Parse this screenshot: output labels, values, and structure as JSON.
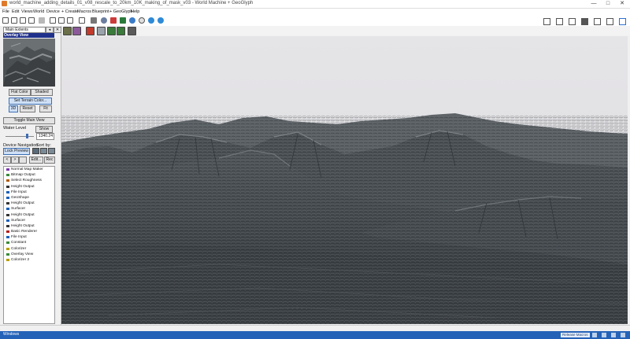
{
  "window": {
    "title": "world_machine_adding_details_01_v08_rescale_to_20km_10K_making_of_mask_v03 - World Machine + GeoGlyph",
    "controls": {
      "minimize": "—",
      "maximize": "□",
      "close": "✕"
    }
  },
  "menu": [
    "File",
    "Edit",
    "Views",
    "World",
    "Device",
    "+ Create",
    "Macros",
    "Blueprint",
    "+ GeoGlyph",
    "Help"
  ],
  "left_panel": {
    "view_dropdown": "Main Extents",
    "overlay_label": "Overlay View",
    "flat_color": "Flat Color",
    "shaded": "Shaded",
    "set_terrain_color": "Set Terrain Color...",
    "btn_3d": "3D",
    "btn_reset": "Reset",
    "btn_fit": "Fit",
    "toggle_main_view": "Toggle Main View",
    "water_level_label": "Water Level",
    "water_show": "Show",
    "water_value": "1340.24",
    "water_level_fraction": 0.78,
    "device_navigation_label": "Device Navigation",
    "sort_by_label": "Sort by:",
    "lock_preview": "Lock Preview",
    "nav_left": "<",
    "nav_right": ">",
    "edit_btn": "Edit...",
    "rec_btn": "Rec",
    "devices": [
      {
        "label": "Normal Map Maker",
        "color": "#7c3aa8"
      },
      {
        "label": "Bitmap Output",
        "color": "#3a8a3a"
      },
      {
        "label": "Select Roughness",
        "color": "#b05a00"
      },
      {
        "label": "Height Output",
        "color": "#333333"
      },
      {
        "label": "File Input",
        "color": "#1b5fb8"
      },
      {
        "label": "GeoShape",
        "color": "#1b5fb8"
      },
      {
        "label": "Height Output",
        "color": "#333333"
      },
      {
        "label": "Surfacer",
        "color": "#1b5fb8"
      },
      {
        "label": "Height Output",
        "color": "#333333"
      },
      {
        "label": "Surfacer",
        "color": "#1b5fb8"
      },
      {
        "label": "Height Output",
        "color": "#333333"
      },
      {
        "label": "Basic Renderer",
        "color": "#b02020"
      },
      {
        "label": "File Input",
        "color": "#1b5fb8"
      },
      {
        "label": "Constant",
        "color": "#3a8a3a"
      },
      {
        "label": "Colorizer",
        "color": "#b8a000"
      },
      {
        "label": "Overlay View",
        "color": "#3a8a3a"
      },
      {
        "label": "Colorizer 2",
        "color": "#b8a000"
      }
    ]
  },
  "status": {
    "taskbar_label": "Windows",
    "task_item": "Release Macros"
  },
  "colors": {
    "accent": "#2462b8",
    "viewport_sky": "#e4e3e6",
    "terrain": "#3b4146"
  }
}
